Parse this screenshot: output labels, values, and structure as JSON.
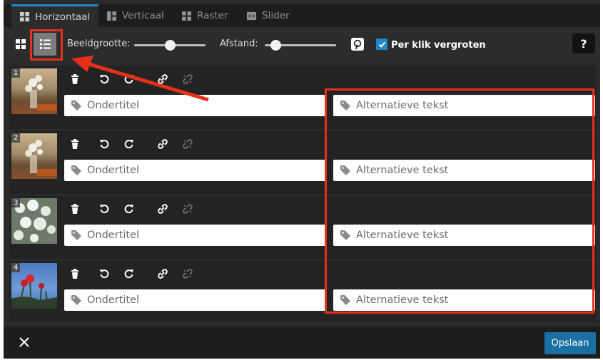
{
  "tabs": [
    {
      "label": "Horizontaal",
      "icon": "horizontal-layout-icon",
      "active": true
    },
    {
      "label": "Verticaal",
      "icon": "vertical-layout-icon",
      "active": false
    },
    {
      "label": "Raster",
      "icon": "grid-layout-icon",
      "active": false
    },
    {
      "label": "Slider",
      "icon": "slider-icon",
      "active": false
    }
  ],
  "toolbar": {
    "image_size_label": "Beeldgrootte:",
    "image_size_value": 0.5,
    "spacing_label": "Afstand:",
    "spacing_value": 0.15,
    "enlarge_label": "Per klik vergroten",
    "enlarge_checked": true,
    "help_label": "?"
  },
  "items": [
    {
      "number": "1",
      "subtitle_placeholder": "Ondertitel",
      "alt_placeholder": "Alternatieve tekst"
    },
    {
      "number": "2",
      "subtitle_placeholder": "Ondertitel",
      "alt_placeholder": "Alternatieve tekst"
    },
    {
      "number": "3",
      "subtitle_placeholder": "Ondertitel",
      "alt_placeholder": "Alternatieve tekst"
    },
    {
      "number": "4",
      "subtitle_placeholder": "Ondertitel",
      "alt_placeholder": "Alternatieve tekst"
    }
  ],
  "footer": {
    "save_label": "Opslaan"
  },
  "colors": {
    "accent": "#1e88c8",
    "highlight": "#e5311a",
    "save": "#1a6fa3"
  }
}
